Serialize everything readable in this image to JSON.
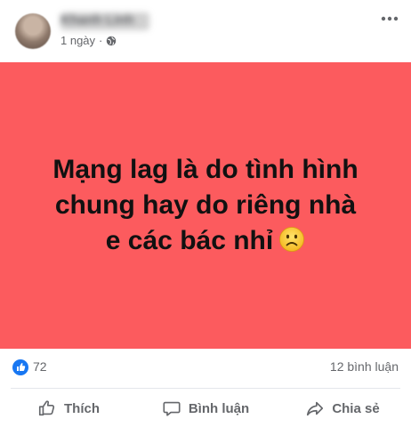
{
  "post": {
    "author_name": "Khanh Linh",
    "time": "1 ngày",
    "separator": "·",
    "text_lines": [
      "Mạng lag là do tình hình",
      "chung hay do riêng nhà",
      "e các bác nhỉ"
    ],
    "background_color": "#fc5b5e",
    "emoji_icon": "sad-face-emoji",
    "privacy_icon": "globe-icon"
  },
  "reactions": {
    "icon": "like-reaction-icon",
    "count": "72"
  },
  "comments": {
    "count_label": "12 bình luận"
  },
  "actions": {
    "like_label": "Thích",
    "comment_label": "Bình luận",
    "share_label": "Chia sẻ"
  },
  "colors": {
    "accent_blue": "#1877f2",
    "muted_text": "#65676b"
  }
}
